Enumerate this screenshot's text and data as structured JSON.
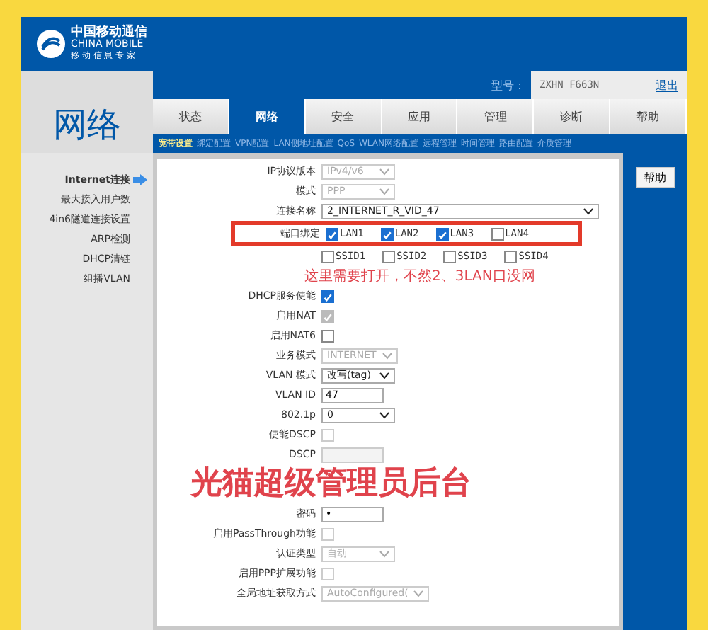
{
  "brand": {
    "name": "中国移动通信",
    "english": "CHINA MOBILE",
    "slogan": "移 动 信 息 专 家"
  },
  "page_title": "网络",
  "model": {
    "label": "型号：",
    "value": "ZXHN F663N",
    "logout": "退出"
  },
  "tabs": [
    {
      "label": "状态",
      "selected": false
    },
    {
      "label": "网络",
      "selected": true
    },
    {
      "label": "安全",
      "selected": false
    },
    {
      "label": "应用",
      "selected": false
    },
    {
      "label": "管理",
      "selected": false
    },
    {
      "label": "诊断",
      "selected": false
    },
    {
      "label": "帮助",
      "selected": false
    }
  ],
  "subtabs": [
    {
      "label": "宽带设置",
      "selected": true
    },
    {
      "label": "绑定配置",
      "selected": false
    },
    {
      "label": "VPN配置",
      "selected": false
    },
    {
      "label": "LAN侧地址配置",
      "selected": false
    },
    {
      "label": "QoS",
      "selected": false
    },
    {
      "label": "WLAN网络配置",
      "selected": false
    },
    {
      "label": "远程管理",
      "selected": false
    },
    {
      "label": "时间管理",
      "selected": false
    },
    {
      "label": "路由配置",
      "selected": false
    },
    {
      "label": "介质管理",
      "selected": false
    }
  ],
  "sidebar": [
    {
      "label": "Internet连接",
      "selected": true
    },
    {
      "label": "最大接入用户数",
      "selected": false
    },
    {
      "label": "4in6隧道连接设置",
      "selected": false
    },
    {
      "label": "ARP检测",
      "selected": false
    },
    {
      "label": "DHCP清链",
      "selected": false
    },
    {
      "label": "组播VLAN",
      "selected": false
    }
  ],
  "form": [
    {
      "kind": "select",
      "label": "IP协议版本",
      "value": "IPv4/v6",
      "disabled": true,
      "wide": false
    },
    {
      "kind": "select",
      "label": "模式",
      "value": "PPP",
      "disabled": true,
      "wide": false
    },
    {
      "kind": "select",
      "label": "连接名称",
      "value": "2_INTERNET_R_VID_47",
      "disabled": false,
      "wide": true
    },
    {
      "kind": "checks",
      "label": "端口绑定",
      "highlighted": true,
      "options": [
        {
          "label": "LAN1",
          "checked": true
        },
        {
          "label": "LAN2",
          "checked": true
        },
        {
          "label": "LAN3",
          "checked": true
        },
        {
          "label": "LAN4",
          "checked": false
        }
      ]
    },
    {
      "kind": "checks",
      "highlighted": false,
      "options": [
        {
          "label": "SSID1",
          "checked": false
        },
        {
          "label": "SSID2",
          "checked": false
        },
        {
          "label": "SSID3",
          "checked": false
        },
        {
          "label": "SSID4",
          "checked": false
        }
      ]
    },
    {
      "kind": "note",
      "text": "这里需要打开，不然2、3LAN口没网"
    },
    {
      "kind": "checkbox",
      "label": "DHCP服务使能",
      "checked": true,
      "disabled": false
    },
    {
      "kind": "checkbox",
      "label": "启用NAT",
      "checked": true,
      "disabled": true
    },
    {
      "kind": "checkbox",
      "label": "启用NAT6",
      "checked": false,
      "disabled": false
    },
    {
      "kind": "select",
      "label": "业务模式",
      "value": "INTERNET",
      "disabled": true,
      "wide": false
    },
    {
      "kind": "select",
      "label": "VLAN 模式",
      "value": "改写(tag)",
      "disabled": false,
      "wide": false
    },
    {
      "kind": "input",
      "label": "VLAN ID",
      "value": "47",
      "disabled": false
    },
    {
      "kind": "select",
      "label": "802.1p",
      "value": "0",
      "disabled": false,
      "wide": false
    },
    {
      "kind": "checkbox",
      "label": "使能DSCP",
      "checked": false,
      "disabled": true
    },
    {
      "kind": "input",
      "label": "DSCP",
      "disabled": true
    },
    {
      "kind": "caption",
      "text": "光猫超级管理员后台"
    },
    {
      "kind": "input",
      "label": "密码",
      "value": "•",
      "disabled": false
    },
    {
      "kind": "checkbox",
      "label": "启用PassThrough功能",
      "checked": false,
      "disabled": true
    },
    {
      "kind": "select",
      "label": "认证类型",
      "value": "自动",
      "disabled": true,
      "wide": false
    },
    {
      "kind": "checkbox",
      "label": "启用PPP扩展功能",
      "checked": false,
      "disabled": true
    },
    {
      "kind": "select",
      "label": "全局地址获取方式",
      "value": "AutoConfigured(",
      "disabled": true,
      "wide": false
    }
  ],
  "help_button": "帮助"
}
